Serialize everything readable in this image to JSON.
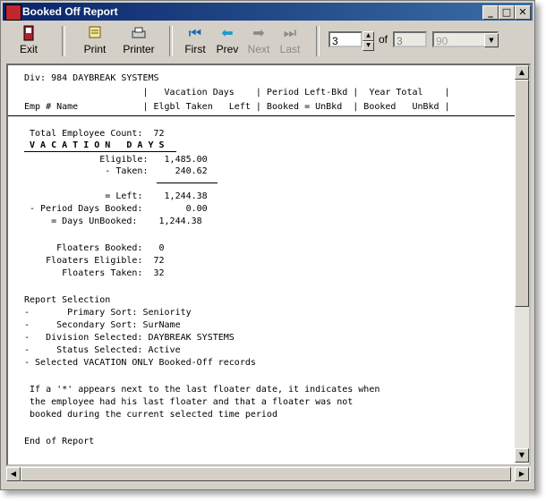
{
  "window": {
    "title": "Booked Off Report"
  },
  "toolbar": {
    "exit": "Exit",
    "print": "Print",
    "printer": "Printer",
    "first": "First",
    "prev": "Prev",
    "next": "Next",
    "last": "Last",
    "page_value": "3",
    "of_label": "of",
    "page_total": "3",
    "zoom_value": "90"
  },
  "report": {
    "div_line": "Div: 984 DAYBREAK SYSTEMS",
    "header1": "                      |   Vacation Days    | Period Left-Bkd |  Year Total    |",
    "header2": "Emp # Name            | Elgbl Taken   Left | Booked = UnBkd  | Booked   UnBkd |",
    "total_count": " Total Employee Count:  72",
    "vac_title": " V A C A T I O N   D A Y S",
    "eligible": "              Eligible:   1,485.00",
    "taken": "               - Taken:     240.62",
    "left": "               = Left:    1,244.38",
    "period_booked": " - Period Days Booked:        0.00",
    "days_unbooked": "     = Days UnBooked:    1,244.38",
    "floaters_booked": "      Floaters Booked:   0",
    "floaters_eligible": "    Floaters Eligible:  72",
    "floaters_taken": "       Floaters Taken:  32",
    "report_selection": "Report Selection",
    "primary_sort": "-       Primary Sort: Seniority",
    "secondary_sort": "-     Secondary Sort: SurName",
    "division_selected": "-   Division Selected: DAYBREAK SYSTEMS",
    "status_selected": "-     Status Selected: Active",
    "selected_records": "- Selected VACATION ONLY Booked-Off records",
    "note1": " If a '*' appears next to the last floater date, it indicates when",
    "note2": " the employee had his last floater and that a floater was not",
    "note3": " booked during the current selected time period",
    "end": "End of Report"
  }
}
